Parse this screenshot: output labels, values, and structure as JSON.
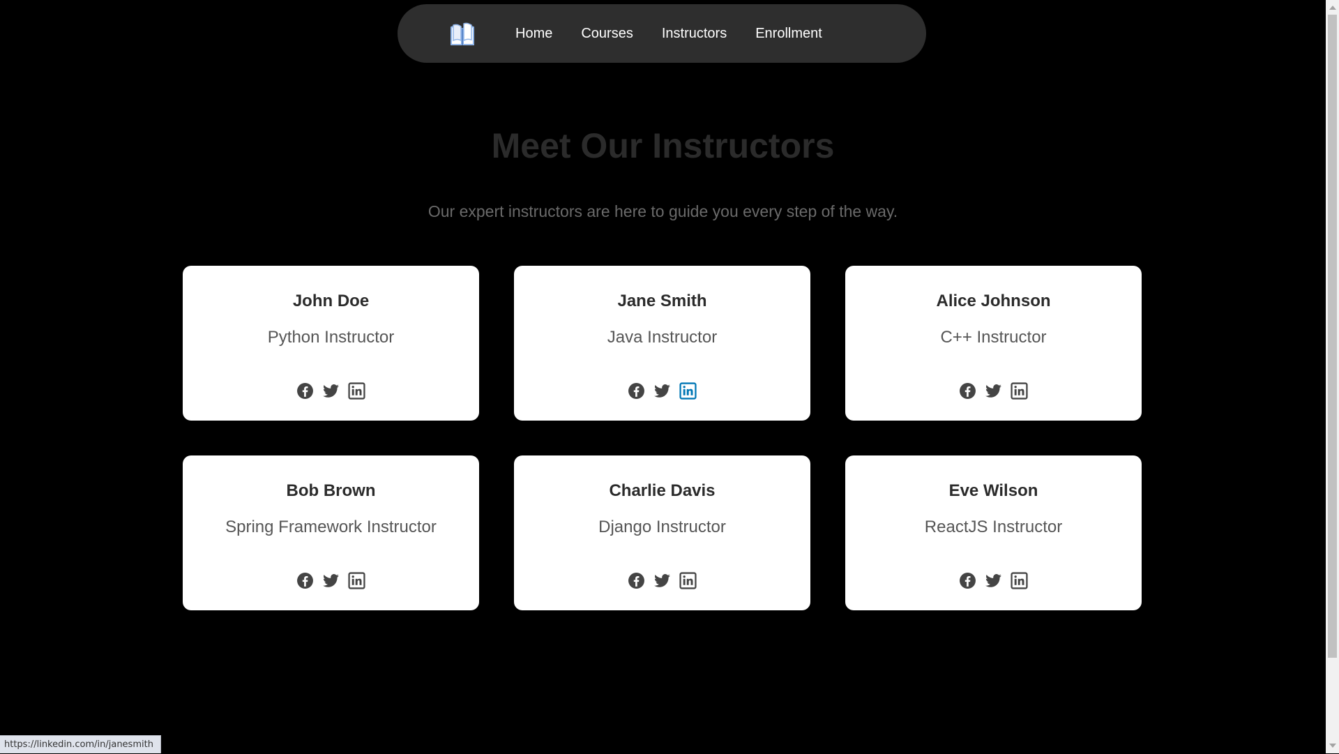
{
  "nav": {
    "logo_icon": "open-book-icon",
    "links": [
      {
        "label": "Home"
      },
      {
        "label": "Courses"
      },
      {
        "label": "Instructors"
      },
      {
        "label": "Enrollment"
      }
    ]
  },
  "header": {
    "title": "Meet Our Instructors",
    "subtitle": "Our expert instructors are here to guide you every step of the way."
  },
  "instructors": [
    {
      "name": "John Doe",
      "role": "Python Instructor"
    },
    {
      "name": "Jane Smith",
      "role": "Java Instructor",
      "hovered_social": "linkedin"
    },
    {
      "name": "Alice Johnson",
      "role": "C++ Instructor"
    },
    {
      "name": "Bob Brown",
      "role": "Spring Framework Instructor"
    },
    {
      "name": "Charlie Davis",
      "role": "Django Instructor"
    },
    {
      "name": "Eve Wilson",
      "role": "ReactJS Instructor"
    }
  ],
  "social_icons": [
    "facebook-icon",
    "twitter-icon",
    "linkedin-icon"
  ],
  "colors": {
    "background": "#000000",
    "navbar": "#2e2e2e",
    "card": "#ffffff",
    "icon": "#444444",
    "icon_hover": "#0077b5"
  },
  "status_bar": {
    "url": "https://linkedin.com/in/janesmith"
  }
}
